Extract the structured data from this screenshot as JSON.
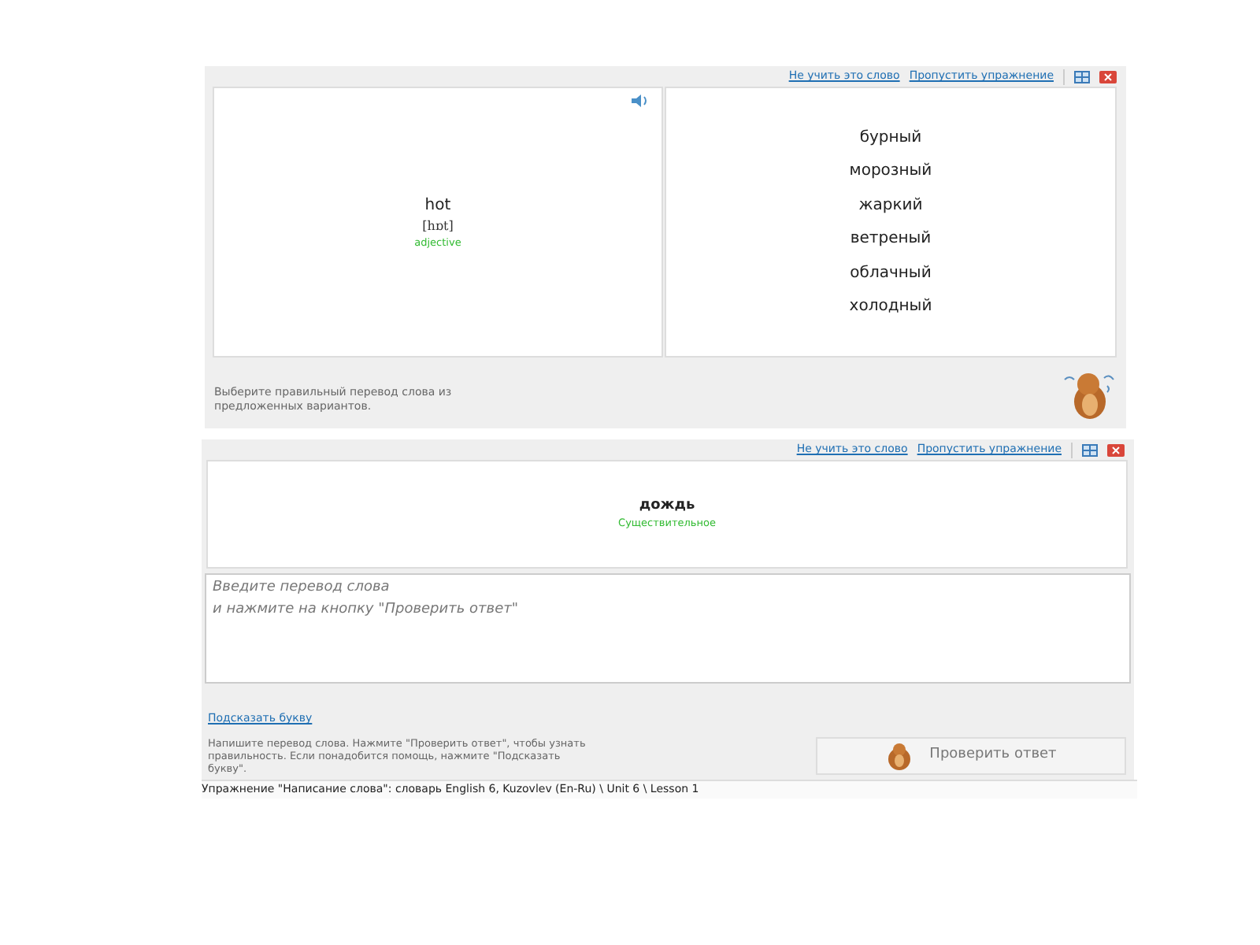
{
  "choice_exercise": {
    "header_links": [
      "Не учить это слово",
      "Пропустить упражнение"
    ],
    "word": "hot",
    "transcription": "[hɒt]",
    "part_of_speech": "adjective",
    "options": [
      "бурный",
      "морозный",
      "жаркий",
      "ветреный",
      "облачный",
      "холодный"
    ],
    "instruction": "Выберите правильный перевод слова из предложенных вариантов."
  },
  "writing_exercise": {
    "header_links": [
      "Не учить это слово",
      "Пропустить упражнение"
    ],
    "word": "дождь",
    "part_of_speech": "Существительное",
    "answer": {
      "placeholder": "Введите перевод слова\nи нажмите на кнопку \"Проверить ответ\""
    },
    "hint_link": "Подсказать букву",
    "instruction": "Напишите перевод слова. Нажмите \"Проверить ответ\", чтобы узнать правильность. Если понадобится помощь, нажмите \"Подсказать букву\".",
    "check_button": "Проверить ответ"
  },
  "status_bar": "Упражнение \"Написание слова\": словарь English 6, Kuzovlev (En-Ru) \\ Unit 6 \\ Lesson 1"
}
